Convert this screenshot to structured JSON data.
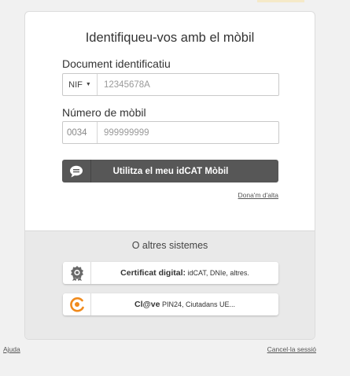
{
  "title": "Identifiqueu-vos amb el mòbil",
  "document": {
    "label": "Document identificatiu",
    "type": "NIF",
    "placeholder": "12345678A"
  },
  "mobile": {
    "label": "Número de mòbil",
    "country_code": "0034",
    "placeholder": "999999999"
  },
  "submit_button": "Utilitza el meu idCAT Mòbil",
  "signup_link": "Dona'm d'alta",
  "other_systems": {
    "title": "O altres sistemes",
    "options": [
      {
        "name": "Certificat digital:",
        "detail": "idCAT, DNIe, altres.",
        "icon": "certificate-badge-icon"
      },
      {
        "name": "Cl@ve",
        "detail": "PIN24, Ciutadans UE...",
        "icon": "clave-logo-icon"
      }
    ]
  },
  "footer": {
    "help": "Ajuda",
    "cancel": "Cancel·la sessió"
  },
  "colors": {
    "button_bg": "#575757",
    "clave_orange": "#f08a1c"
  }
}
